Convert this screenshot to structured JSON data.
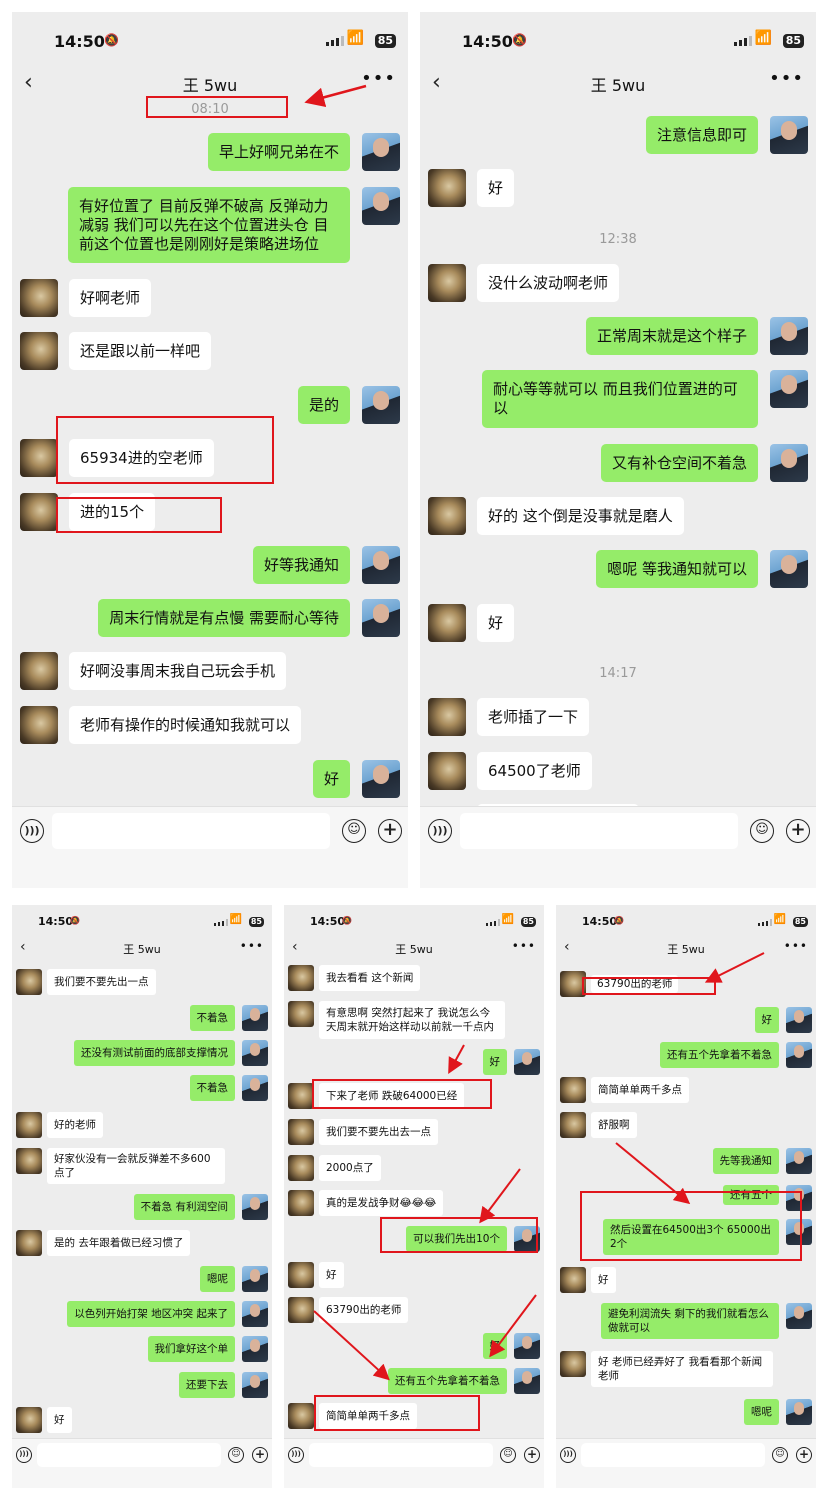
{
  "status": {
    "time": "14:50",
    "battery": "85"
  },
  "contact": "王 5wu",
  "panels": [
    {
      "timestamps": [
        "08:10"
      ],
      "messages": [
        {
          "from": "me",
          "text": "早上好啊兄弟在不"
        },
        {
          "from": "me",
          "text": "有好位置了 目前反弹不破高 反弹动力减弱 我们可以先在这个位置进头仓 目前这个位置也是刚刚好是策略进场位"
        },
        {
          "from": "other",
          "text": "好啊老师"
        },
        {
          "from": "other",
          "text": "还是跟以前一样吧"
        },
        {
          "from": "me",
          "text": "是的"
        },
        {
          "from": "other",
          "text": "65934进的空老师"
        },
        {
          "from": "other",
          "text": "进的15个"
        },
        {
          "from": "me",
          "text": "好等我通知"
        },
        {
          "from": "me",
          "text": "周末行情就是有点慢 需要耐心等待"
        },
        {
          "from": "other",
          "text": "好啊没事周末我自己玩会手机"
        },
        {
          "from": "other",
          "text": "老师有操作的时候通知我就可以"
        },
        {
          "from": "me",
          "text": "好"
        }
      ]
    },
    {
      "timestamps": [
        "12:38",
        "14:17"
      ],
      "messages": [
        {
          "from": "me",
          "text": "注意信息即可"
        },
        {
          "from": "other",
          "text": "好"
        },
        {
          "from": "other",
          "text": "没什么波动啊老师"
        },
        {
          "from": "me",
          "text": "正常周末就是这个样子"
        },
        {
          "from": "me",
          "text": "耐心等等就可以 而且我们位置进的可以"
        },
        {
          "from": "me",
          "text": "又有补仓空间不着急"
        },
        {
          "from": "other",
          "text": "好的 这个倒是没事就是磨人"
        },
        {
          "from": "me",
          "text": "嗯呢 等我通知就可以"
        },
        {
          "from": "other",
          "text": "好"
        },
        {
          "from": "other",
          "text": "老师插了一下"
        },
        {
          "from": "other",
          "text": "64500了老师"
        }
      ]
    },
    {
      "messages": [
        {
          "from": "other",
          "text": "我们要不要先出一点"
        },
        {
          "from": "me",
          "text": "不着急"
        },
        {
          "from": "me",
          "text": "还没有测试前面的底部支撑情况"
        },
        {
          "from": "me",
          "text": "不着急"
        },
        {
          "from": "other",
          "text": "好的老师"
        },
        {
          "from": "other",
          "text": "好家伙没有一会就反弹差不多600点了"
        },
        {
          "from": "me",
          "text": "不着急 有利润空间"
        },
        {
          "from": "other",
          "text": "是的 去年跟着做已经习惯了"
        },
        {
          "from": "me",
          "text": "嗯呢"
        },
        {
          "from": "me",
          "text": "以色列开始打架 地区冲突 起来了"
        },
        {
          "from": "me",
          "text": "我们拿好这个单"
        },
        {
          "from": "me",
          "text": "还要下去"
        },
        {
          "from": "other",
          "text": "好"
        }
      ]
    },
    {
      "messages": [
        {
          "from": "other",
          "text": "我去看看 这个新闻"
        },
        {
          "from": "other",
          "text": "有意思啊 突然打起来了 我说怎么今天周末就开始这样动以前就一千点内"
        },
        {
          "from": "me",
          "text": "好"
        },
        {
          "from": "other",
          "text": "下来了老师 跌破64000已经"
        },
        {
          "from": "other",
          "text": "我们要不要先出去一点"
        },
        {
          "from": "other",
          "text": "2000点了"
        },
        {
          "from": "other",
          "text": "真的是发战争财😂😂😂"
        },
        {
          "from": "me",
          "text": "可以我们先出10个"
        },
        {
          "from": "other",
          "text": "好"
        },
        {
          "from": "other",
          "text": "63790出的老师"
        },
        {
          "from": "me",
          "text": "好"
        },
        {
          "from": "me",
          "text": "还有五个先拿着不着急"
        },
        {
          "from": "other",
          "text": "简简单单两千多点"
        }
      ]
    },
    {
      "messages": [
        {
          "from": "other",
          "text": "63790出的老师"
        },
        {
          "from": "me",
          "text": "好"
        },
        {
          "from": "me",
          "text": "还有五个先拿着不着急"
        },
        {
          "from": "other",
          "text": "简简单单两千多点"
        },
        {
          "from": "other",
          "text": "舒服啊"
        },
        {
          "from": "me",
          "text": "先等我通知"
        },
        {
          "from": "me",
          "text": "还有五个"
        },
        {
          "from": "me",
          "text": "然后设置在64500出3个 65000出2个"
        },
        {
          "from": "other",
          "text": "好"
        },
        {
          "from": "me",
          "text": "避免利润流失 剩下的我们就看怎么做就可以"
        },
        {
          "from": "other",
          "text": "好 老师已经弄好了 我看看那个新闻老师"
        },
        {
          "from": "me",
          "text": "嗯呢"
        }
      ]
    }
  ],
  "icons": {
    "voice": "voice-icon",
    "emoji": "emoji-icon",
    "plus": "plus-icon",
    "back": "back-chevron-icon",
    "more": "more-icon"
  },
  "colors": {
    "my_bubble": "#95ec69",
    "other_bubble": "#ffffff",
    "background": "#ededed",
    "annotation": "#e0161c"
  }
}
